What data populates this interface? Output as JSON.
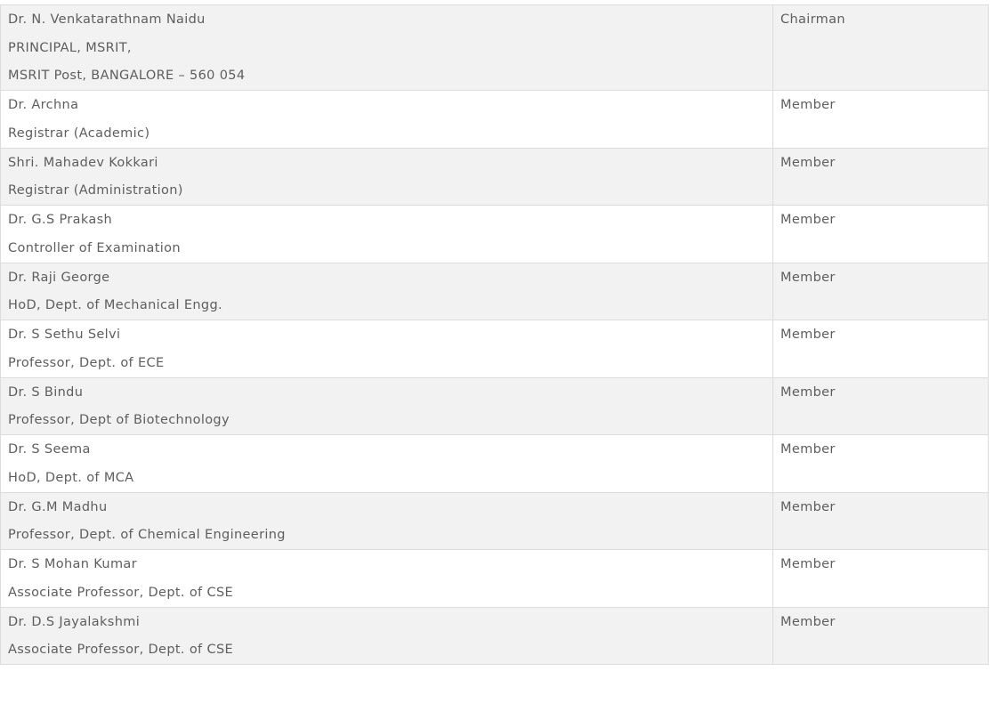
{
  "rows": [
    {
      "lines": [
        "Dr. N. Venkatarathnam Naidu",
        "PRINCIPAL, MSRIT,",
        "MSRIT Post, BANGALORE – 560 054"
      ],
      "role": "Chairman"
    },
    {
      "lines": [
        "Dr. Archna",
        "Registrar (Academic)"
      ],
      "role": "Member"
    },
    {
      "lines": [
        "Shri. Mahadev Kokkari",
        "Registrar (Administration)"
      ],
      "role": "Member"
    },
    {
      "lines": [
        "Dr. G.S Prakash",
        "Controller of Examination"
      ],
      "role": "Member"
    },
    {
      "lines": [
        "Dr. Raji George",
        "HoD, Dept. of Mechanical Engg."
      ],
      "role": "Member"
    },
    {
      "lines": [
        "Dr. S Sethu Selvi",
        "Professor, Dept. of ECE"
      ],
      "role": "Member"
    },
    {
      "lines": [
        "Dr. S Bindu",
        "Professor, Dept of Biotechnology"
      ],
      "role": "Member"
    },
    {
      "lines": [
        "Dr. S Seema",
        "HoD, Dept. of MCA"
      ],
      "role": "Member"
    },
    {
      "lines": [
        "Dr. G.M Madhu",
        "Professor, Dept. of Chemical Engineering"
      ],
      "role": "Member"
    },
    {
      "lines": [
        "Dr. S Mohan Kumar",
        "Associate Professor, Dept. of CSE"
      ],
      "role": "Member"
    },
    {
      "lines": [
        "Dr. D.S Jayalakshmi",
        "Associate Professor, Dept. of CSE"
      ],
      "role": "Member"
    }
  ]
}
